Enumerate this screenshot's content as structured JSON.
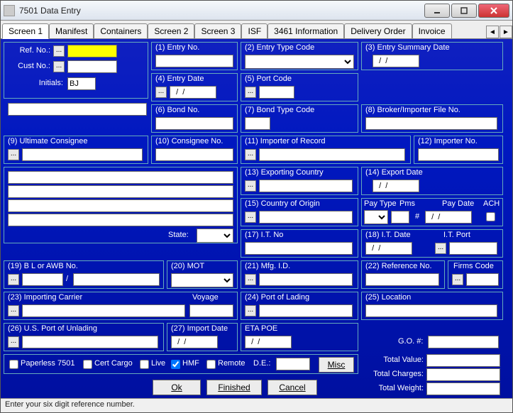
{
  "window": {
    "title": "7501 Data Entry"
  },
  "tabs": {
    "items": [
      "Screen 1",
      "Manifest",
      "Containers",
      "Screen 2",
      "Screen 3",
      "ISF",
      "3461 Information",
      "Delivery Order",
      "Invoice"
    ],
    "active": 0,
    "left": "◄",
    "right": "►"
  },
  "left": {
    "refno": "Ref. No.:",
    "custno": "Cust No.:",
    "initials": "Initials:",
    "initials_val": "BJ",
    "state": "State:"
  },
  "f": {
    "entry_no": "(1) Entry No.",
    "entry_type": "(2) Entry Type Code",
    "summary_date": "(3) Entry Summary Date",
    "summary_date_val": "  /  /",
    "entry_date": "(4) Entry Date",
    "entry_date_val": "  /  /",
    "port_code": "(5) Port Code",
    "bond_no": "(6) Bond No.",
    "bond_type": "(7) Bond Type Code",
    "broker_file": "(8) Broker/Importer File No.",
    "ult_consignee": "(9) Ultimate Consignee",
    "consignee_no": "(10) Consignee No.",
    "importer_rec": "(11) Importer of Record",
    "importer_no": "(12) Importer No.",
    "export_country": "(13) Exporting Country",
    "export_date": "(14) Export Date",
    "export_date_val": "  /  /",
    "country_origin": "(15) Country of Origin",
    "paytype": "Pay Type",
    "pms": "Pms",
    "paydate": "Pay Date",
    "paydate_val": "  /  /",
    "ach": "ACH",
    "it_no": "(17) I.T. No",
    "it_date": "(18) I.T. Date",
    "it_date_val": "  /  /",
    "it_port": "I.T. Port",
    "bl": "(19) B L or AWB No.",
    "mot": "(20) MOT",
    "mfg": "(21) Mfg. I.D.",
    "ref_no": "(22) Reference No.",
    "firms": "Firms Code",
    "imp_carrier": "(23) Importing Carrier",
    "voyage": "Voyage",
    "port_lading": "(24) Port of Lading",
    "location": "(25) Location",
    "us_port": "(26) U.S. Port of Unlading",
    "import_date": "(27) Import Date",
    "import_date_val": "  /  /",
    "eta": "ETA POE",
    "eta_val": "  /  /",
    "go": "G.O. #:"
  },
  "chk": {
    "paperless": "Paperless 7501",
    "cert": "Cert Cargo",
    "live": "Live",
    "hmf": "HMF",
    "hmf_checked": true,
    "remote": "Remote",
    "de": "D.E.:"
  },
  "totals": {
    "value": "Total Value:",
    "charges": "Total Charges:",
    "weight": "Total Weight:"
  },
  "buttons": {
    "misc": "Misc",
    "ok": "Ok",
    "finished": "Finished",
    "cancel": "Cancel"
  },
  "hash": "#",
  "slash": "/",
  "status": "Enter your six digit reference number."
}
